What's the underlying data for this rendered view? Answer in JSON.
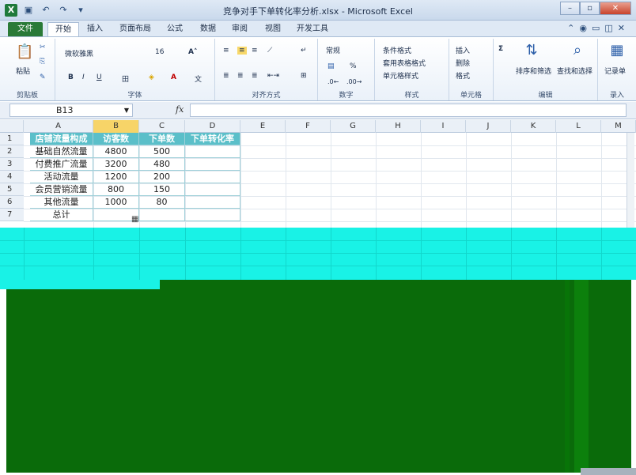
{
  "window": {
    "title": "竞争对手下单转化率分析.xlsx - Microsoft Excel",
    "app_icon": "X"
  },
  "tabs": {
    "file": "文件",
    "items": [
      "开始",
      "插入",
      "页面布局",
      "公式",
      "数据",
      "审阅",
      "视图",
      "开发工具"
    ],
    "active": "开始"
  },
  "ribbon": {
    "clipboard": {
      "paste": "粘贴",
      "label": "剪贴板"
    },
    "font": {
      "name": "微软雅黑",
      "size": "16",
      "bold": "B",
      "italic": "I",
      "underline": "U",
      "label": "字体"
    },
    "alignment": {
      "label": "对齐方式"
    },
    "number": {
      "format": "常规",
      "percent": "%",
      "label": "数字"
    },
    "styles": {
      "conditional": "条件格式",
      "table": "套用表格格式",
      "cell": "单元格样式",
      "label": "样式"
    },
    "cells": {
      "insert": "插入",
      "delete": "删除",
      "format": "格式",
      "label": "单元格"
    },
    "editing": {
      "sort": "排序和筛选",
      "find": "查找和选择",
      "label": "编辑"
    },
    "record": {
      "button": "记录单",
      "label": "录入"
    }
  },
  "formula_bar": {
    "name_box": "B13",
    "fx": "fx",
    "value": ""
  },
  "columns": [
    "A",
    "B",
    "C",
    "D",
    "E",
    "F",
    "G",
    "H",
    "I",
    "J",
    "K",
    "L",
    "M"
  ],
  "selected_column": "B",
  "rows": [
    "1",
    "2",
    "3",
    "4",
    "5",
    "6",
    "7"
  ],
  "table": {
    "headers": [
      "店铺流量构成",
      "访客数",
      "下单数",
      "下单转化率"
    ],
    "rows": [
      [
        "基础自然流量",
        "4800",
        "500",
        ""
      ],
      [
        "付费推广流量",
        "3200",
        "480",
        ""
      ],
      [
        "活动流量",
        "1200",
        "200",
        ""
      ],
      [
        "会员营销流量",
        "800",
        "150",
        ""
      ],
      [
        "其他流量",
        "1000",
        "80",
        ""
      ],
      [
        "总计",
        "",
        "",
        ""
      ]
    ]
  },
  "colors": {
    "header_fill": "#5bbfc9",
    "file_tab": "#2a7a37",
    "glitch_cyan": "#19f2e6",
    "glitch_green": "#0a6b0a"
  }
}
